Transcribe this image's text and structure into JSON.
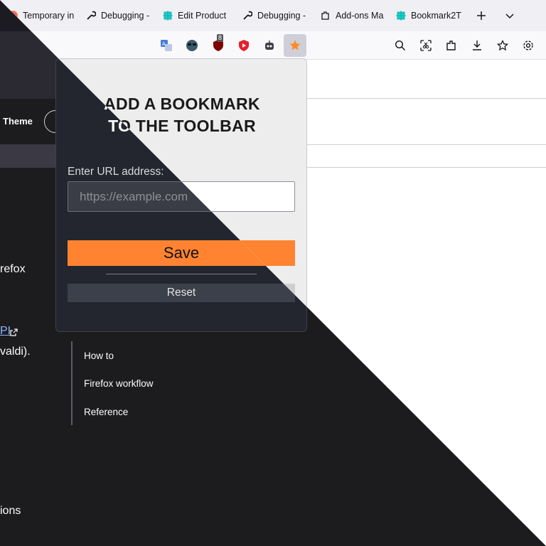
{
  "tabs": [
    {
      "label": "Temporary in",
      "icon": "firefox-icon"
    },
    {
      "label": "Debugging -",
      "icon": "wrench-icon"
    },
    {
      "label": "Edit Product",
      "icon": "extension-puzzle-icon"
    },
    {
      "label": "Debugging -",
      "icon": "wrench-icon"
    },
    {
      "label": "Add-ons Ma",
      "icon": "puzzle-piece-icon"
    },
    {
      "label": "Bookmark2T",
      "icon": "extension-puzzle-icon"
    }
  ],
  "toolbar": {
    "ublock_badge": "8"
  },
  "page": {
    "theme_label": "Theme",
    "text_refox": "refox",
    "link_pi": "PI",
    "text_valdi": "valdi).",
    "text_ions": "ions",
    "side_nav": [
      "How to",
      "Firefox workflow",
      "Reference"
    ]
  },
  "popup": {
    "title_line1": "ADD A BOOKMARK",
    "title_line2": "TO THE TOOLBAR",
    "url_label": "Enter URL address:",
    "url_placeholder": "https://example.com",
    "save_label": "Save",
    "reset_label": "Reset"
  },
  "colors": {
    "accent_orange": "#ff8330",
    "dark_bg": "#1c1b1e",
    "light_bg": "#ffffff"
  }
}
